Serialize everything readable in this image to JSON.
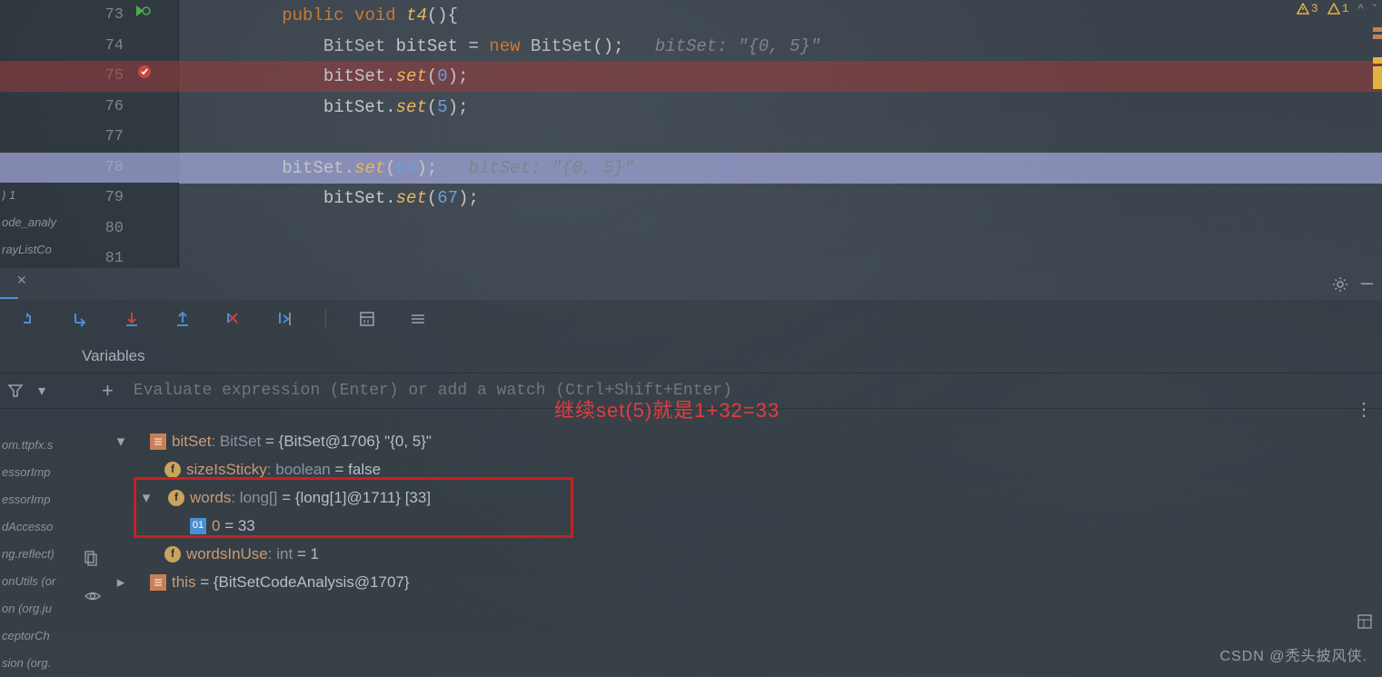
{
  "topright": {
    "warn1_label": "3",
    "warn2_label": "1"
  },
  "editor": {
    "lines": [
      {
        "n": "73",
        "indent": "        ",
        "tokens": [
          [
            "kw",
            "public"
          ],
          [
            "punct",
            " "
          ],
          [
            "kw",
            "void"
          ],
          [
            "punct",
            " "
          ],
          [
            "method",
            "t4"
          ],
          [
            "punct",
            "(){"
          ]
        ]
      },
      {
        "n": "74",
        "indent": "            ",
        "tokens": [
          [
            "type",
            "BitSet"
          ],
          [
            "punct",
            " "
          ],
          [
            "ident",
            "bitSet"
          ],
          [
            "punct",
            " = "
          ],
          [
            "kw",
            "new"
          ],
          [
            "punct",
            " "
          ],
          [
            "type",
            "BitSet"
          ],
          [
            "punct",
            "();   "
          ],
          [
            "comm",
            "bitSet: \"{0, 5}\""
          ]
        ]
      },
      {
        "n": "75",
        "indent": "            ",
        "hl": "red",
        "tokens": [
          [
            "ident",
            "bitSet"
          ],
          [
            "punct",
            "."
          ],
          [
            "method",
            "set"
          ],
          [
            "punct",
            "("
          ],
          [
            "num",
            "0"
          ],
          [
            "punct",
            ");"
          ]
        ]
      },
      {
        "n": "76",
        "indent": "            ",
        "tokens": [
          [
            "ident",
            "bitSet"
          ],
          [
            "punct",
            "."
          ],
          [
            "method",
            "set"
          ],
          [
            "punct",
            "("
          ],
          [
            "num",
            "5"
          ],
          [
            "punct",
            ");"
          ]
        ]
      },
      {
        "n": "77",
        "indent": "",
        "tokens": []
      },
      {
        "n": "78",
        "indent": "        ",
        "hl": "blue",
        "tokens": [
          [
            "ident",
            "bitSet"
          ],
          [
            "punct",
            "."
          ],
          [
            "method",
            "set"
          ],
          [
            "punct",
            "("
          ],
          [
            "num",
            "64"
          ],
          [
            "punct",
            ");   "
          ],
          [
            "comm",
            "bitSet: \"{0, 5}\""
          ]
        ]
      },
      {
        "n": "79",
        "indent": "            ",
        "tokens": [
          [
            "ident",
            "bitSet"
          ],
          [
            "punct",
            "."
          ],
          [
            "method",
            "set"
          ],
          [
            "punct",
            "("
          ],
          [
            "num",
            "67"
          ],
          [
            "punct",
            ");"
          ]
        ]
      },
      {
        "n": "80",
        "indent": "",
        "tokens": []
      },
      {
        "n": "81",
        "indent": "",
        "tokens": []
      }
    ]
  },
  "side_strip": {
    "items": [
      ") 1",
      "ode_analy",
      "rayListCo"
    ]
  },
  "debug": {
    "variables_label": "Variables",
    "eval_placeholder": "Evaluate expression (Enter) or add a watch (Ctrl+Shift+Enter)"
  },
  "side_strip2": {
    "items": [
      "om.ttpfx.s",
      "essorImp",
      "essorImp",
      "dAccesso",
      "ng.reflect)",
      "onUtils (or",
      "on (org.ju",
      "ceptorCh",
      "sion (org."
    ]
  },
  "vars": {
    "root_name": "bitSet",
    "root_type": ": BitSet ",
    "root_val": " = {BitSet@1706} \"{0, 5}\"",
    "sticky_name": "sizeIsSticky",
    "sticky_type": ": boolean ",
    "sticky_val": " = false",
    "words_name": "words",
    "words_type": ": long[] ",
    "words_val": " = {long[1]@1711} [33]",
    "words0_name": "0",
    "words0_val": " = 33",
    "inuse_name": "wordsInUse",
    "inuse_type": ": int ",
    "inuse_val": " = 1",
    "this_name": "this",
    "this_val": " = {BitSetCodeAnalysis@1707}"
  },
  "annotation": "继续set(5)就是1+32=33",
  "watermark": "CSDN @秃头披风侠."
}
